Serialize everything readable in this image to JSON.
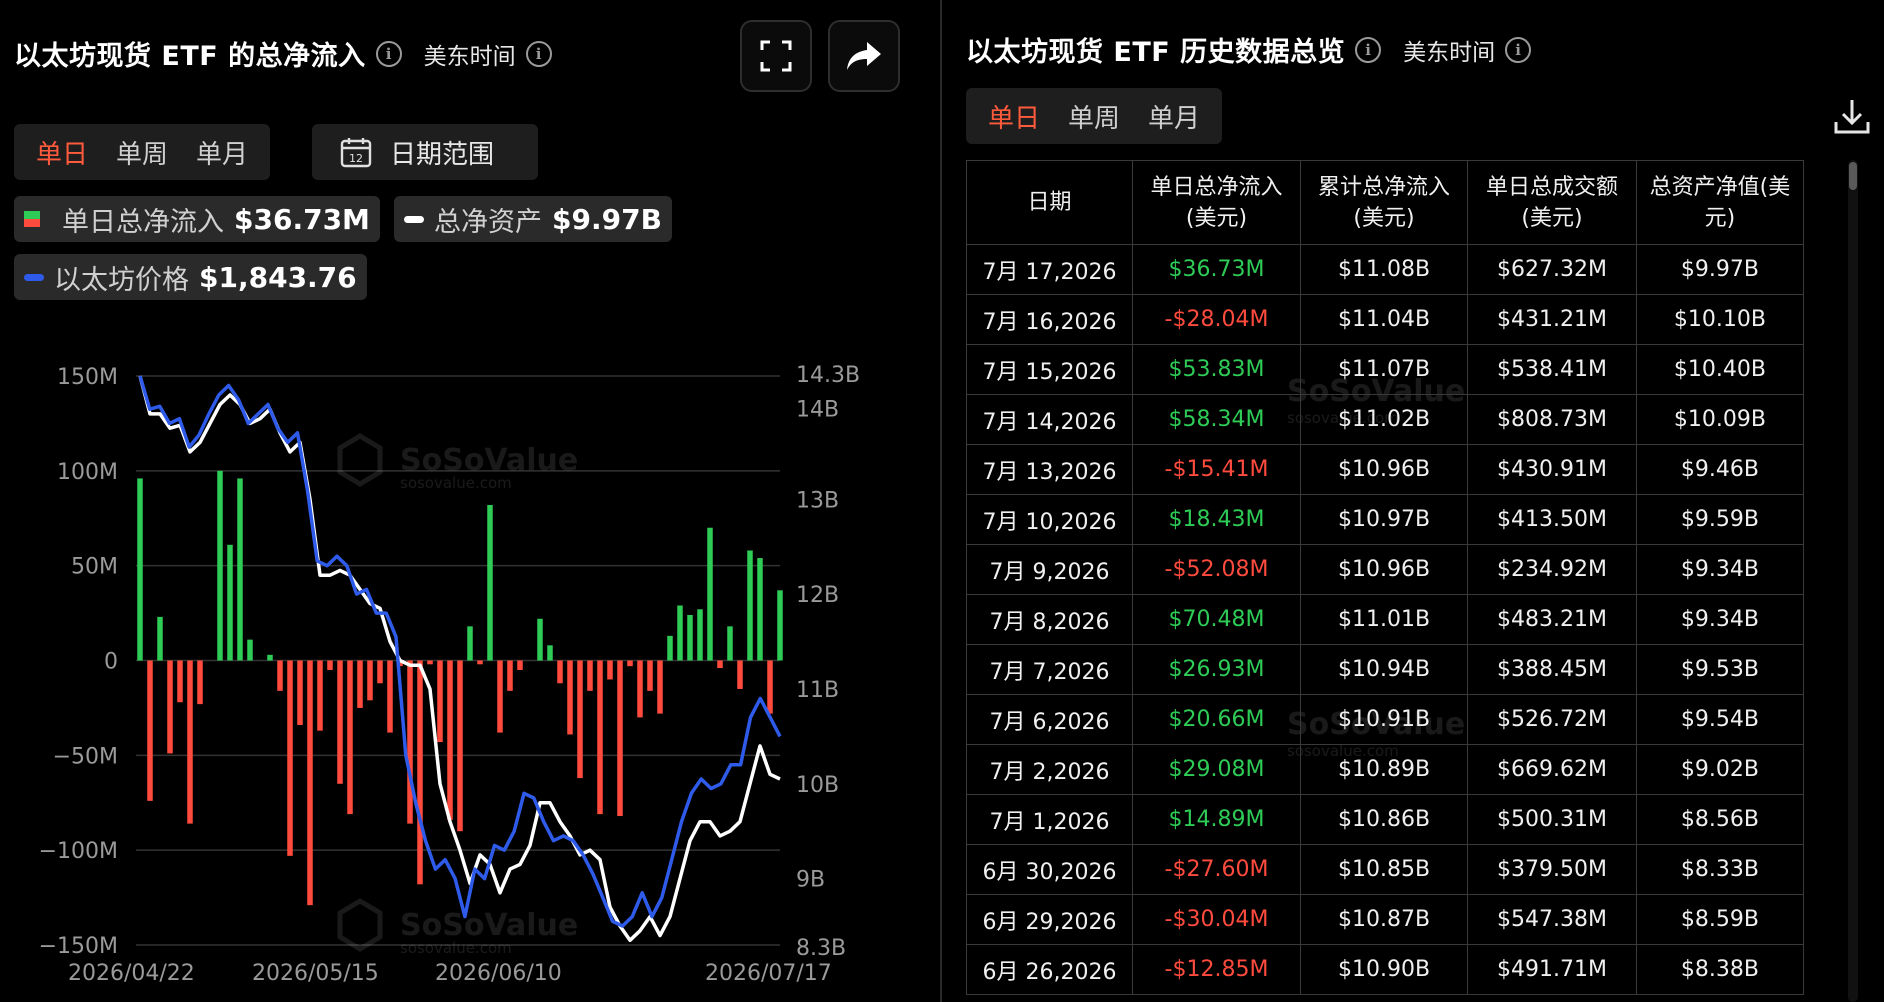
{
  "left": {
    "title": "以太坊现货 ETF 的总净流入",
    "timezone": "美东时间",
    "info_icon": "info-icon",
    "fullscreen_icon": "fullscreen-icon",
    "share_icon": "share-icon",
    "tabs": [
      "单日",
      "单周",
      "单月"
    ],
    "active_tab": "单日",
    "date_range_label": "日期范围",
    "date_range_icon_text": "12",
    "legend": {
      "net_inflow_label": "单日总净流入",
      "net_inflow_value": "$36.73M",
      "net_assets_label": "总净资产",
      "net_assets_value": "$9.97B",
      "price_label": "以太坊价格",
      "price_value": "$1,843.76"
    },
    "watermark": "SoSoValue",
    "watermark_sub": "sosovalue.com"
  },
  "colors": {
    "positive": "#2ecc56",
    "negative": "#ff4b3e",
    "price_line": "#2f5bea",
    "assets_line": "#ffffff",
    "active_tab": "#ff5a3c"
  },
  "chart_data": {
    "type": "bar",
    "x_tick_labels": [
      "2026/04/22",
      "2026/05/15",
      "2026/06/10",
      "2026/07/17"
    ],
    "left_axis": {
      "ticks": [
        "150M",
        "100M",
        "50M",
        "0",
        "−50M",
        "−100M",
        "−150M"
      ],
      "ylim": [
        -150,
        150
      ]
    },
    "right_axis": {
      "ticks": [
        "14.3B",
        "14B",
        "13B",
        "12B",
        "11B",
        "10B",
        "9B",
        "8.3B"
      ],
      "ylim": [
        8.3,
        14.3
      ]
    },
    "grid": true,
    "series": [
      {
        "name": "单日总净流入",
        "type": "bar",
        "values": [
          96,
          -74,
          23,
          -49,
          -22,
          -86,
          -23,
          0,
          100,
          61,
          96,
          11,
          0,
          3,
          -16,
          -103,
          -34,
          -129,
          -37,
          -5,
          -65,
          -81,
          -25,
          -21,
          -12,
          -38,
          -3,
          -86,
          -118,
          -2,
          -43,
          -84,
          -90,
          18,
          -2,
          82,
          -38,
          -16,
          -5,
          0,
          22,
          8,
          -12,
          -39,
          -62,
          -16,
          -81,
          -10,
          -82,
          -3,
          -30,
          -16,
          -28,
          13,
          29,
          24,
          27,
          70,
          -4,
          18,
          -15,
          58,
          54,
          -28,
          37
        ],
        "unit": "M"
      },
      {
        "name": "总净资产",
        "type": "line",
        "values": [
          14.3,
          13.9,
          13.9,
          13.75,
          13.78,
          13.5,
          13.6,
          13.8,
          14.0,
          14.1,
          14.0,
          13.8,
          13.85,
          13.95,
          13.7,
          13.5,
          13.6,
          13.0,
          12.2,
          12.2,
          12.25,
          12.2,
          12.05,
          11.9,
          11.85,
          11.5,
          11.3,
          11.25,
          11.25,
          11.0,
          10.0,
          9.6,
          9.3,
          8.95,
          9.25,
          9.15,
          8.85,
          9.1,
          9.15,
          9.35,
          9.8,
          9.8,
          9.6,
          9.45,
          9.25,
          9.3,
          9.2,
          8.7,
          8.5,
          8.35,
          8.45,
          8.6,
          8.4,
          8.6,
          9.0,
          9.4,
          9.6,
          9.6,
          9.45,
          9.5,
          9.6,
          10.0,
          10.4,
          10.1,
          10.05
        ],
        "unit": "B"
      },
      {
        "name": "以太坊价格",
        "type": "line",
        "values": [
          14.3,
          13.95,
          13.98,
          13.8,
          13.85,
          13.55,
          13.68,
          13.9,
          14.1,
          14.2,
          14.05,
          13.8,
          13.9,
          14.0,
          13.75,
          13.6,
          13.7,
          13.1,
          12.35,
          12.3,
          12.4,
          12.3,
          12.0,
          12.05,
          11.8,
          11.8,
          11.55,
          10.3,
          9.8,
          9.4,
          9.1,
          9.2,
          9.0,
          8.6,
          9.1,
          9.0,
          9.35,
          9.3,
          9.5,
          9.9,
          9.85,
          9.6,
          9.4,
          9.45,
          9.4,
          9.25,
          9.05,
          8.8,
          8.55,
          8.5,
          8.6,
          8.85,
          8.6,
          8.8,
          9.2,
          9.6,
          9.9,
          10.05,
          9.95,
          10.0,
          10.2,
          10.2,
          10.7,
          10.9,
          10.7,
          10.5
        ],
        "unit": "B"
      }
    ]
  },
  "right": {
    "title": "以太坊现货 ETF 历史数据总览",
    "timezone": "美东时间",
    "tabs": [
      "单日",
      "单周",
      "单月"
    ],
    "active_tab": "单日",
    "download_icon": "download-icon",
    "watermark": "SoSoValue",
    "watermark_sub": "sosovalue.com",
    "columns": [
      "日期",
      "单日总净流入\n(美元)",
      "累计总净流入\n(美元)",
      "单日总成交额\n(美元)",
      "总资产净值(美\n元)"
    ],
    "rows": [
      {
        "date": "7月 17,2026",
        "inflow": "$36.73M",
        "sign": "pos",
        "cum": "$11.08B",
        "vol": "$627.32M",
        "nav": "$9.97B"
      },
      {
        "date": "7月 16,2026",
        "inflow": "-$28.04M",
        "sign": "neg",
        "cum": "$11.04B",
        "vol": "$431.21M",
        "nav": "$10.10B"
      },
      {
        "date": "7月 15,2026",
        "inflow": "$53.83M",
        "sign": "pos",
        "cum": "$11.07B",
        "vol": "$538.41M",
        "nav": "$10.40B"
      },
      {
        "date": "7月 14,2026",
        "inflow": "$58.34M",
        "sign": "pos",
        "cum": "$11.02B",
        "vol": "$808.73M",
        "nav": "$10.09B"
      },
      {
        "date": "7月 13,2026",
        "inflow": "-$15.41M",
        "sign": "neg",
        "cum": "$10.96B",
        "vol": "$430.91M",
        "nav": "$9.46B"
      },
      {
        "date": "7月 10,2026",
        "inflow": "$18.43M",
        "sign": "pos",
        "cum": "$10.97B",
        "vol": "$413.50M",
        "nav": "$9.59B"
      },
      {
        "date": "7月 9,2026",
        "inflow": "-$52.08M",
        "sign": "neg",
        "cum": "$10.96B",
        "vol": "$234.92M",
        "nav": "$9.34B"
      },
      {
        "date": "7月 8,2026",
        "inflow": "$70.48M",
        "sign": "pos",
        "cum": "$11.01B",
        "vol": "$483.21M",
        "nav": "$9.34B"
      },
      {
        "date": "7月 7,2026",
        "inflow": "$26.93M",
        "sign": "pos",
        "cum": "$10.94B",
        "vol": "$388.45M",
        "nav": "$9.53B"
      },
      {
        "date": "7月 6,2026",
        "inflow": "$20.66M",
        "sign": "pos",
        "cum": "$10.91B",
        "vol": "$526.72M",
        "nav": "$9.54B"
      },
      {
        "date": "7月 2,2026",
        "inflow": "$29.08M",
        "sign": "pos",
        "cum": "$10.89B",
        "vol": "$669.62M",
        "nav": "$9.02B"
      },
      {
        "date": "7月 1,2026",
        "inflow": "$14.89M",
        "sign": "pos",
        "cum": "$10.86B",
        "vol": "$500.31M",
        "nav": "$8.56B"
      },
      {
        "date": "6月 30,2026",
        "inflow": "-$27.60M",
        "sign": "neg",
        "cum": "$10.85B",
        "vol": "$379.50M",
        "nav": "$8.33B"
      },
      {
        "date": "6月 29,2026",
        "inflow": "-$30.04M",
        "sign": "neg",
        "cum": "$10.87B",
        "vol": "$547.38M",
        "nav": "$8.59B"
      },
      {
        "date": "6月 26,2026",
        "inflow": "-$12.85M",
        "sign": "neg",
        "cum": "$10.90B",
        "vol": "$491.71M",
        "nav": "$8.38B"
      }
    ]
  }
}
